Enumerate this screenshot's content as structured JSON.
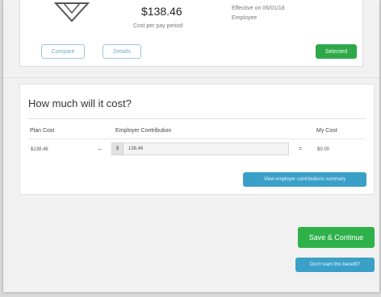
{
  "plan": {
    "cost": "$138.46",
    "cost_sub": "Cost per pay period",
    "effective_line1": "Effective on 06/01/18",
    "effective_line2": "Employee",
    "compare_label": "Compare",
    "details_label": "Details",
    "selected_label": "Selected"
  },
  "cost_section": {
    "title": "How much will it cost?",
    "headers": {
      "plan_cost": "Plan Cost",
      "employer_contribution": "Employer Contribution",
      "my_cost": "My Cost"
    },
    "row": {
      "plan_cost": "$138.46",
      "minus": "−",
      "prefix": "$",
      "employer_value": "138.46",
      "equals": "=",
      "my_cost": "$0.00"
    },
    "summary_button": "View employer contributions summary"
  },
  "actions": {
    "save_continue": "Save & Continue",
    "dont_want": "Don't want this benefit?"
  },
  "colors": {
    "green": "#2fb14a",
    "blue": "#3aa0c8"
  }
}
